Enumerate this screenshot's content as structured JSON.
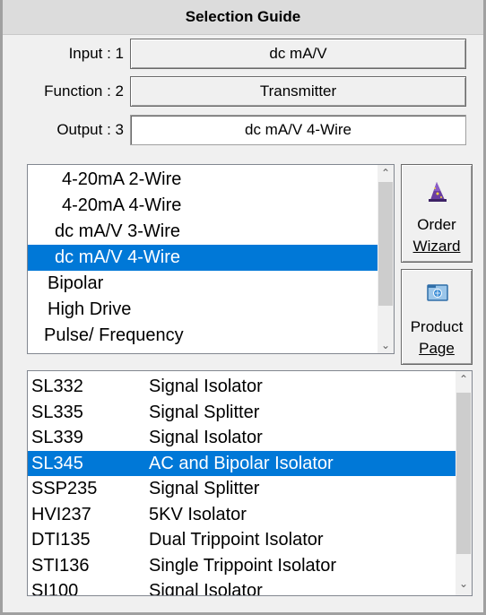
{
  "title": "Selection Guide",
  "selectors": [
    {
      "label": "Input : 1",
      "value": "dc mA/V"
    },
    {
      "label": "Function : 2",
      "value": "Transmitter"
    },
    {
      "label": "Output : 3",
      "value": "dc mA/V 4-Wire"
    }
  ],
  "output_list": {
    "items": [
      "4-20mA 2-Wire",
      "4-20mA 4-Wire",
      "dc mA/V 3-Wire",
      "dc mA/V 4-Wire",
      "Bipolar",
      "High Drive",
      "Pulse/ Frequency"
    ],
    "selected_index": 3
  },
  "buttons": {
    "order_wizard": {
      "line1": "Order",
      "line2": "Wizard",
      "icon": "wizard-hat-icon"
    },
    "product_page": {
      "line1": "Product",
      "line2": "Page",
      "icon": "product-page-icon"
    }
  },
  "products": {
    "items": [
      {
        "code": "SL332",
        "desc": "Signal Isolator"
      },
      {
        "code": "SL335",
        "desc": "Signal Splitter"
      },
      {
        "code": "SL339",
        "desc": "Signal Isolator"
      },
      {
        "code": "SL345",
        "desc": "AC and Bipolar Isolator"
      },
      {
        "code": "SSP235",
        "desc": "Signal Splitter"
      },
      {
        "code": "HVI237",
        "desc": "5KV Isolator"
      },
      {
        "code": "DTI135",
        "desc": "Dual Trippoint Isolator"
      },
      {
        "code": "STI136",
        "desc": "Single Trippoint Isolator"
      },
      {
        "code": "SI100",
        "desc": "Signal Isolator"
      }
    ],
    "selected_index": 3
  },
  "colors": {
    "selection": "#0078d7",
    "window": "#f0f0f0",
    "title_bar": "#dcdcdc"
  }
}
